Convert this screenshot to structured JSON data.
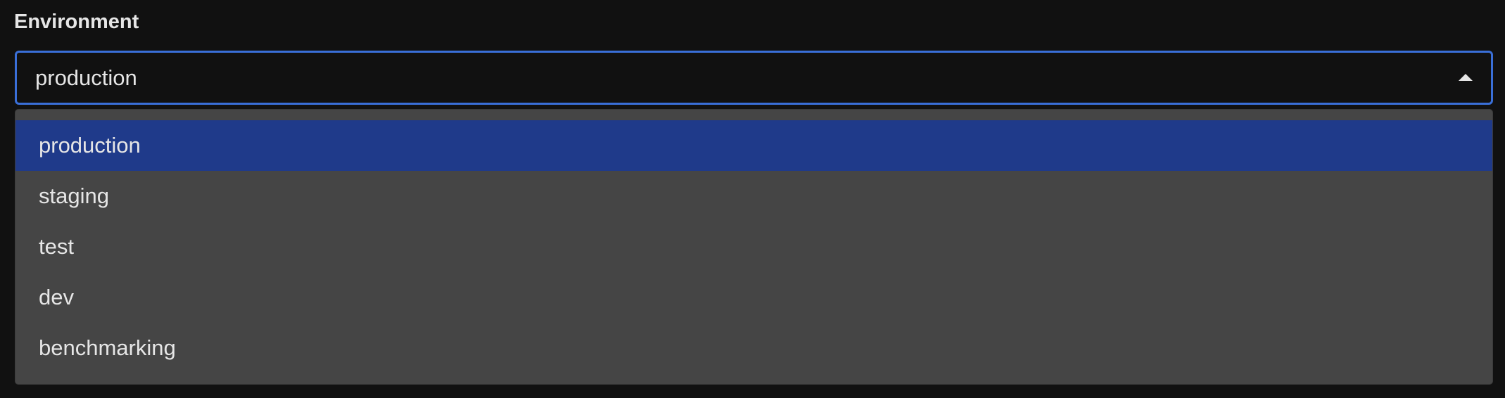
{
  "field": {
    "label": "Environment",
    "selected_value": "production"
  },
  "dropdown": {
    "options": [
      {
        "label": "production",
        "selected": true
      },
      {
        "label": "staging",
        "selected": false
      },
      {
        "label": "test",
        "selected": false
      },
      {
        "label": "dev",
        "selected": false
      },
      {
        "label": "benchmarking",
        "selected": false
      }
    ]
  },
  "icons": {
    "caret": "caret-up-icon"
  },
  "colors": {
    "background": "#111111",
    "focus_border": "#3a6fd8",
    "menu_background": "#454545",
    "selected_option": "#1f3a8a",
    "text": "#e6e6e6"
  }
}
